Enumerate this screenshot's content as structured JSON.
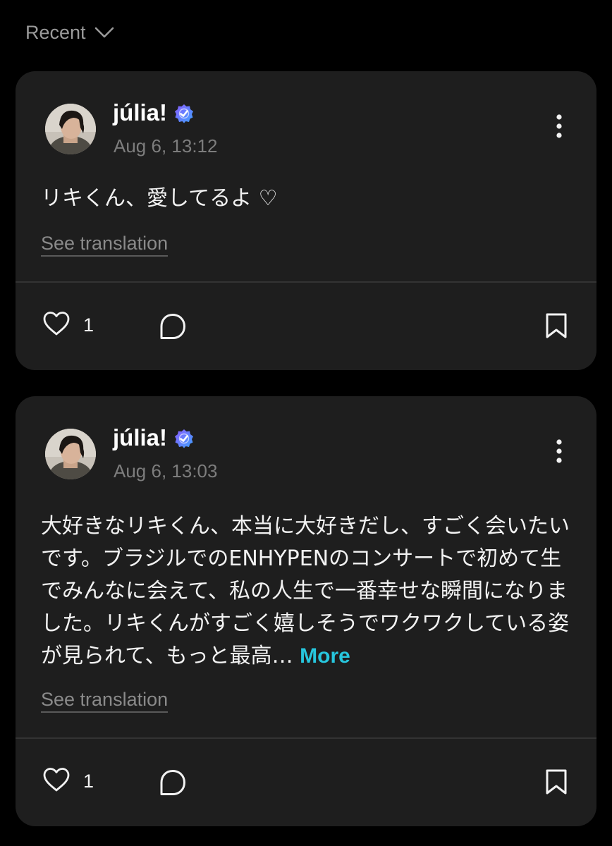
{
  "filter": {
    "label": "Recent",
    "icon": "chevron-down-icon"
  },
  "posts": [
    {
      "author": "júlia!",
      "verified_icon": "verified-badge-icon",
      "timestamp": "Aug 6, 13:12",
      "text": "リキくん、愛してるよ ♡",
      "more_label": "",
      "translate_label": "See translation",
      "likes": "1",
      "actions": [
        "heart-icon",
        "comment-icon",
        "bookmark-icon"
      ]
    },
    {
      "author": "júlia!",
      "verified_icon": "verified-badge-icon",
      "timestamp": "Aug 6, 13:03",
      "text": "大好きなリキくん、本当に大好きだし、すごく会いたいです。ブラジルでのENHYPENのコンサートで初めて生でみんなに会えて、私の人生で一番幸せな瞬間になりました。リキくんがすごく嬉しそうでワクワクしている姿が見られて、もっと最高…",
      "more_label": "More",
      "translate_label": "See translation",
      "likes": "1",
      "actions": [
        "heart-icon",
        "comment-icon",
        "bookmark-icon"
      ]
    }
  ],
  "colors": {
    "background": "#000000",
    "card": "#1e1e1e",
    "accent_more": "#27c6dd",
    "secondary_text": "#7d7d7d",
    "verified_gradient": [
      "#7a5cff",
      "#3fa2ff"
    ]
  }
}
